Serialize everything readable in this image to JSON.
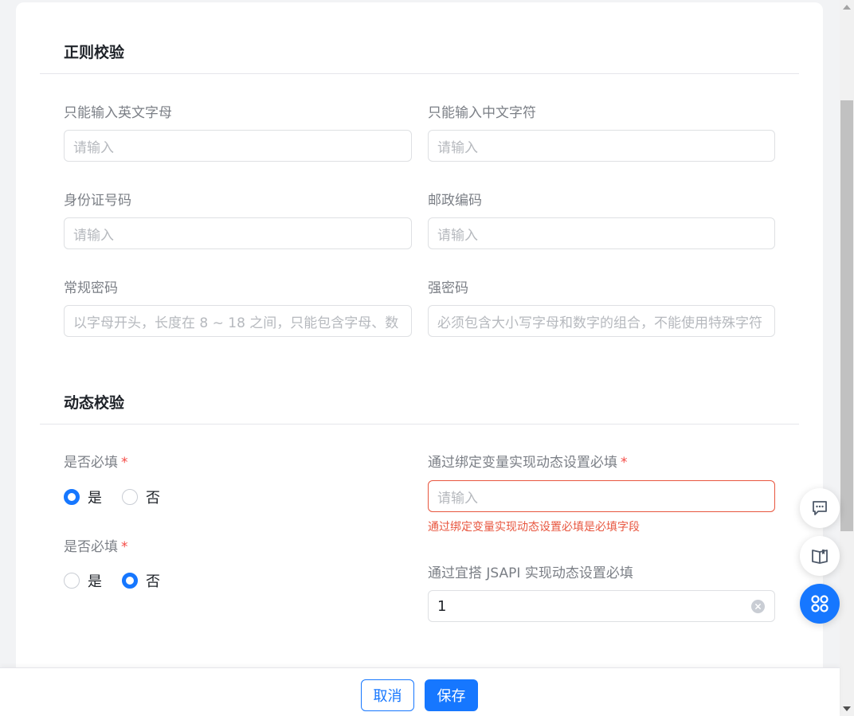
{
  "sections": {
    "regex_title": "正则校验",
    "dynamic_title": "动态校验"
  },
  "regex_fields": {
    "english_only": {
      "label": "只能输入英文字母",
      "placeholder": "请输入"
    },
    "chinese_only": {
      "label": "只能输入中文字符",
      "placeholder": "请输入"
    },
    "id_number": {
      "label": "身份证号码",
      "placeholder": "请输入"
    },
    "postal_code": {
      "label": "邮政编码",
      "placeholder": "请输入"
    },
    "normal_password": {
      "label": "常规密码",
      "placeholder": "以字母开头，长度在 8 ~ 18 之间，只能包含字母、数"
    },
    "strong_password": {
      "label": "强密码",
      "placeholder": "必须包含大小写字母和数字的组合，不能使用特殊字符"
    }
  },
  "dynamic_fields": {
    "required_1": {
      "label": "是否必填",
      "required_mark": "*",
      "options": [
        "是",
        "否"
      ],
      "selected": "是"
    },
    "required_2": {
      "label": "是否必填",
      "required_mark": "*",
      "options": [
        "是",
        "否"
      ],
      "selected": "否"
    },
    "bind_var": {
      "label": "通过绑定变量实现动态设置必填",
      "required_mark": "*",
      "placeholder": "请输入",
      "error": "通过绑定变量实现动态设置必填是必填字段"
    },
    "jsapi": {
      "label": "通过宜搭 JSAPI 实现动态设置必填",
      "value": "1"
    }
  },
  "footer": {
    "cancel_label": "取消",
    "save_label": "保存"
  },
  "floating_buttons": [
    "chat-icon",
    "book-icon",
    "apps-grid-icon"
  ],
  "colors": {
    "primary": "#1677ff",
    "error": "#e8563f",
    "required": "#f54a45"
  }
}
